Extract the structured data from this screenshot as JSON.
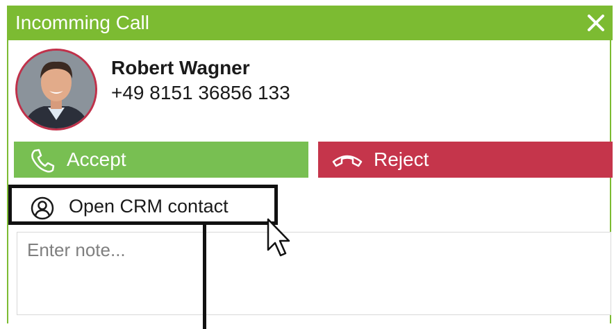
{
  "window": {
    "title": "Incomming Call",
    "close_icon": "close-icon"
  },
  "caller": {
    "name": "Robert Wagner",
    "phone": "+49 8151 36856 133",
    "avatar": "avatar-photo"
  },
  "actions": {
    "accept_label": "Accept",
    "accept_icon": "phone-icon",
    "reject_label": "Reject",
    "reject_icon": "hang-up-icon"
  },
  "crm": {
    "label": "Open CRM contact",
    "icon": "user-circle-icon"
  },
  "note": {
    "placeholder": "Enter note..."
  },
  "colors": {
    "title_bar": "#7cbb32",
    "accept": "#78bf52",
    "reject": "#c5354b",
    "avatar_ring": "#c0314a",
    "highlight_box": "#111111"
  }
}
